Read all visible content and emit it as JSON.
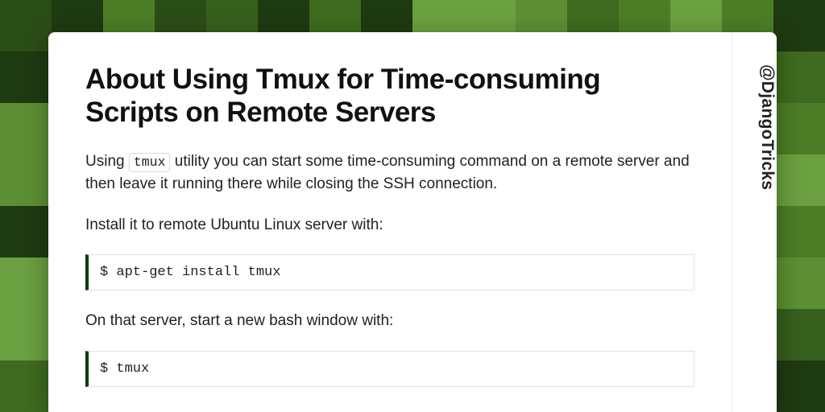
{
  "article": {
    "title": "About Using Tmux for Time-consuming Scripts on Remote Servers",
    "intro_pre": "Using ",
    "intro_code": "tmux",
    "intro_post": " utility you can start some time-consuming command on a remote server and then leave it running there while closing the SSH connection.",
    "install_label": "Install it to remote Ubuntu Linux server with:",
    "install_cmd": "$ apt-get install tmux",
    "start_label": "On that server, start a new bash window with:",
    "start_cmd": "$ tmux"
  },
  "handle": "@DjangoTricks",
  "bg_palette": [
    "#1e3a11",
    "#2a4d16",
    "#365f1c",
    "#3e6b1f",
    "#4b7d26",
    "#5c8f33",
    "#6aa040"
  ]
}
